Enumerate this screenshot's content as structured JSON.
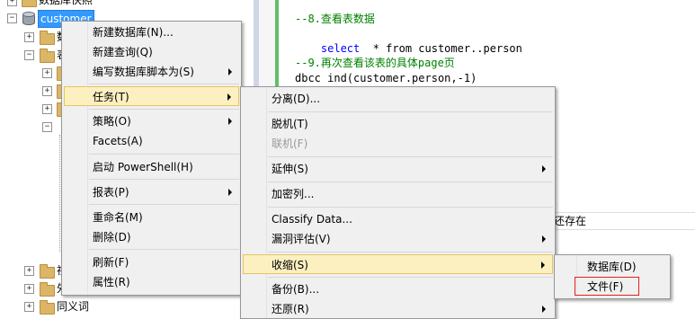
{
  "tree": {
    "top_partial_label": "数据库快照",
    "selected_db": "customer",
    "partial_labels": [
      "数",
      "表",
      "视",
      "外"
    ],
    "bottom_label": "同义词"
  },
  "editor": {
    "lines": [
      {
        "type": "comment",
        "text": "--8.查看表数据"
      },
      {
        "type": "sql1",
        "kw": "select",
        "rest": "  * from customer..person"
      },
      {
        "type": "blank",
        "text": ""
      },
      {
        "type": "comment",
        "text": "--9.再次查看该表的具体page页"
      },
      {
        "type": "sql2",
        "text": "dbcc ind(customer.person,-1)"
      }
    ],
    "partial_text": "还存在"
  },
  "menu_main": {
    "items": [
      {
        "label": "新建数据库(N)...",
        "sub": false
      },
      {
        "label": "新建查询(Q)",
        "sub": false
      },
      {
        "label": "编写数据库脚本为(S)",
        "sub": true
      },
      {
        "label": "任务(T)",
        "sub": true,
        "highlight": true
      },
      {
        "label": "策略(O)",
        "sub": true
      },
      {
        "label": "Facets(A)",
        "sub": false
      },
      {
        "label": "启动 PowerShell(H)",
        "sub": false
      },
      {
        "label": "报表(P)",
        "sub": true
      },
      {
        "label": "重命名(M)",
        "sub": false
      },
      {
        "label": "删除(D)",
        "sub": false
      },
      {
        "label": "刷新(F)",
        "sub": false
      },
      {
        "label": "属性(R)",
        "sub": false
      }
    ]
  },
  "menu_tasks": {
    "items": [
      {
        "label": "分离(D)...",
        "sub": false
      },
      {
        "label": "脱机(T)",
        "sub": false
      },
      {
        "label": "联机(F)",
        "sub": false,
        "disabled": true
      },
      {
        "label": "延伸(S)",
        "sub": true
      },
      {
        "label": "加密列...",
        "sub": false
      },
      {
        "label": "Classify Data...",
        "sub": false
      },
      {
        "label": "漏洞评估(V)",
        "sub": true
      },
      {
        "label": "收缩(S)",
        "sub": true,
        "highlight": true
      },
      {
        "label": "备份(B)...",
        "sub": false
      },
      {
        "label": "还原(R)",
        "sub": true
      }
    ]
  },
  "menu_shrink": {
    "items": [
      {
        "label": "数据库(D)"
      },
      {
        "label": "文件(F)"
      }
    ]
  },
  "colors": {
    "selection": "#3399ff",
    "menu_highlight": "#fcf0c1",
    "comment": "#008000",
    "keyword": "#0000ff",
    "annotation_box": "#e11f1f"
  }
}
